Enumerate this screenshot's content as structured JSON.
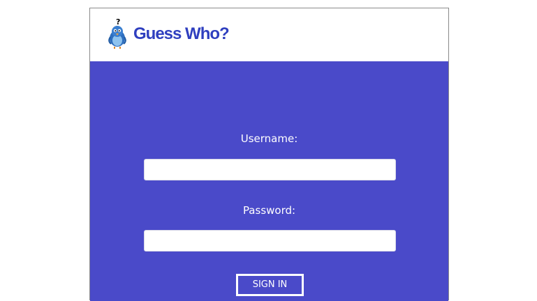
{
  "app": {
    "title": "Guess Who?",
    "logo_icon": "bird-question-icon"
  },
  "login": {
    "username_label": "Username:",
    "username_value": "",
    "password_label": "Password:",
    "password_value": "",
    "submit_label": "SIGN IN"
  },
  "colors": {
    "panel_background": "#4a4ac9",
    "title_color": "#2f3fbf",
    "header_background": "#ffffff",
    "label_color": "#ffffff"
  }
}
